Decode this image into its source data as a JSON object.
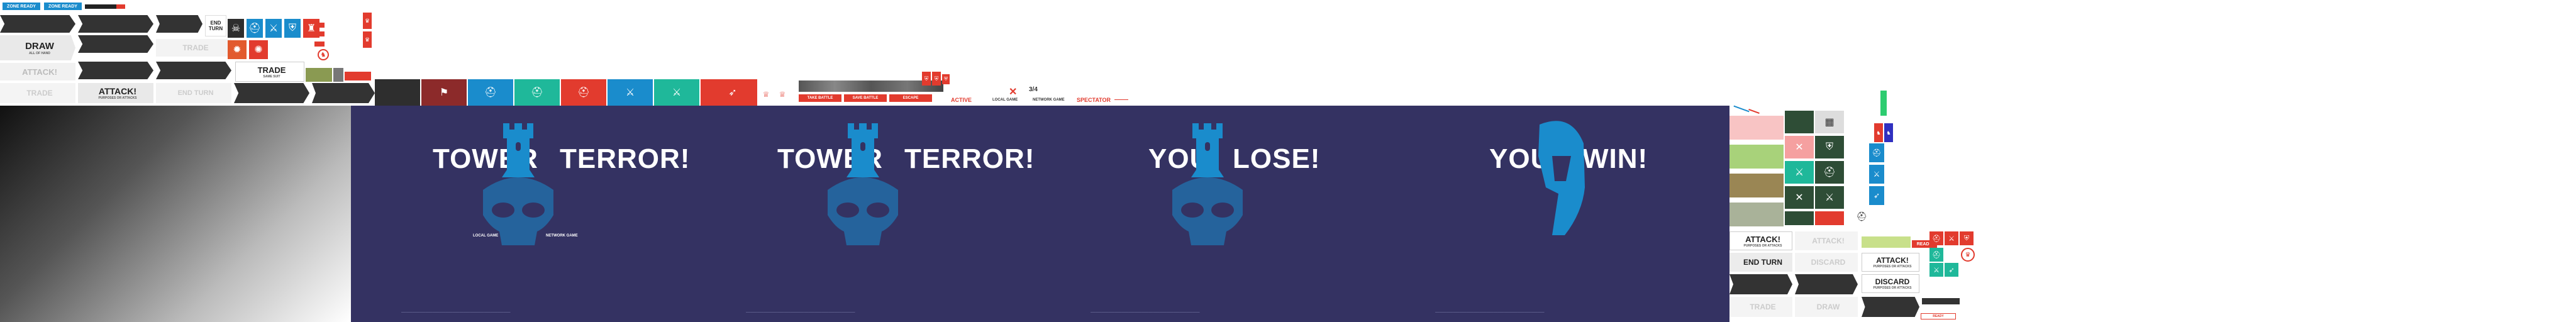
{
  "top_buttons": {
    "zone_ready": "ZONE READY",
    "zone_ready_2": "ZONE READY"
  },
  "left_panels": {
    "draw_title": "DRAW",
    "draw_sub": "ALL OF HAND",
    "attack_title": "ATTACK!",
    "attack_sub": "PURPOSES OR ATTACKS",
    "trade_title": "TRADE",
    "trade_sub": "SAME SUIT",
    "end_turn_title": "END TURN",
    "end_title": "END TURN",
    "draw2_title": "DRAW",
    "trade2_title": "TRADE",
    "attack2_title": "ATTACK!"
  },
  "top_labels": {
    "active": "ACTIVE",
    "local_game": "LOCAL GAME",
    "network_game": "NETWORK GAME",
    "spectator": "SPECTATOR",
    "tag1": "TAKE BATTLE",
    "tag2": "SAVE BATTLE",
    "tag3": "ESCAPE",
    "num": "3/4",
    "close_symbol": "✕"
  },
  "screens": [
    {
      "left": "TOWER",
      "right": "TERROR!",
      "menu": [
        "LOCAL GAME",
        "NETWORK GAME"
      ]
    },
    {
      "left": "TOWER",
      "right": "TERROR!",
      "menu": []
    },
    {
      "left": "YOU",
      "right": "LOSE!",
      "menu": []
    },
    {
      "left": "YOU",
      "right": "WIN!",
      "menu": []
    }
  ],
  "right_panels": {
    "attack_title": "ATTACK!",
    "attack_sub": "PURPOSES OR ATTACKS",
    "end_turn": "END TURN",
    "discard": "DISCARD",
    "discard_sub": "PURPOSES OR ATTACKS",
    "trade": "TRADE",
    "draw": "DRAW",
    "attack2": "ATTACK!",
    "attack2_sub": "PURPOSES OR ATTACKS",
    "ready": "READY",
    "ready2": "READY"
  },
  "colors": {
    "screen_bg": "#343262",
    "accent_blue": "#1a8ccc",
    "red": "#e23b2e",
    "teal": "#1fb89a",
    "dark": "#2e2e2e"
  },
  "icons": [
    "tower-icon",
    "skull-icon",
    "helmet-icon",
    "sword-icon",
    "shield-icon",
    "arrow-icon",
    "crossed-swords-icon"
  ]
}
